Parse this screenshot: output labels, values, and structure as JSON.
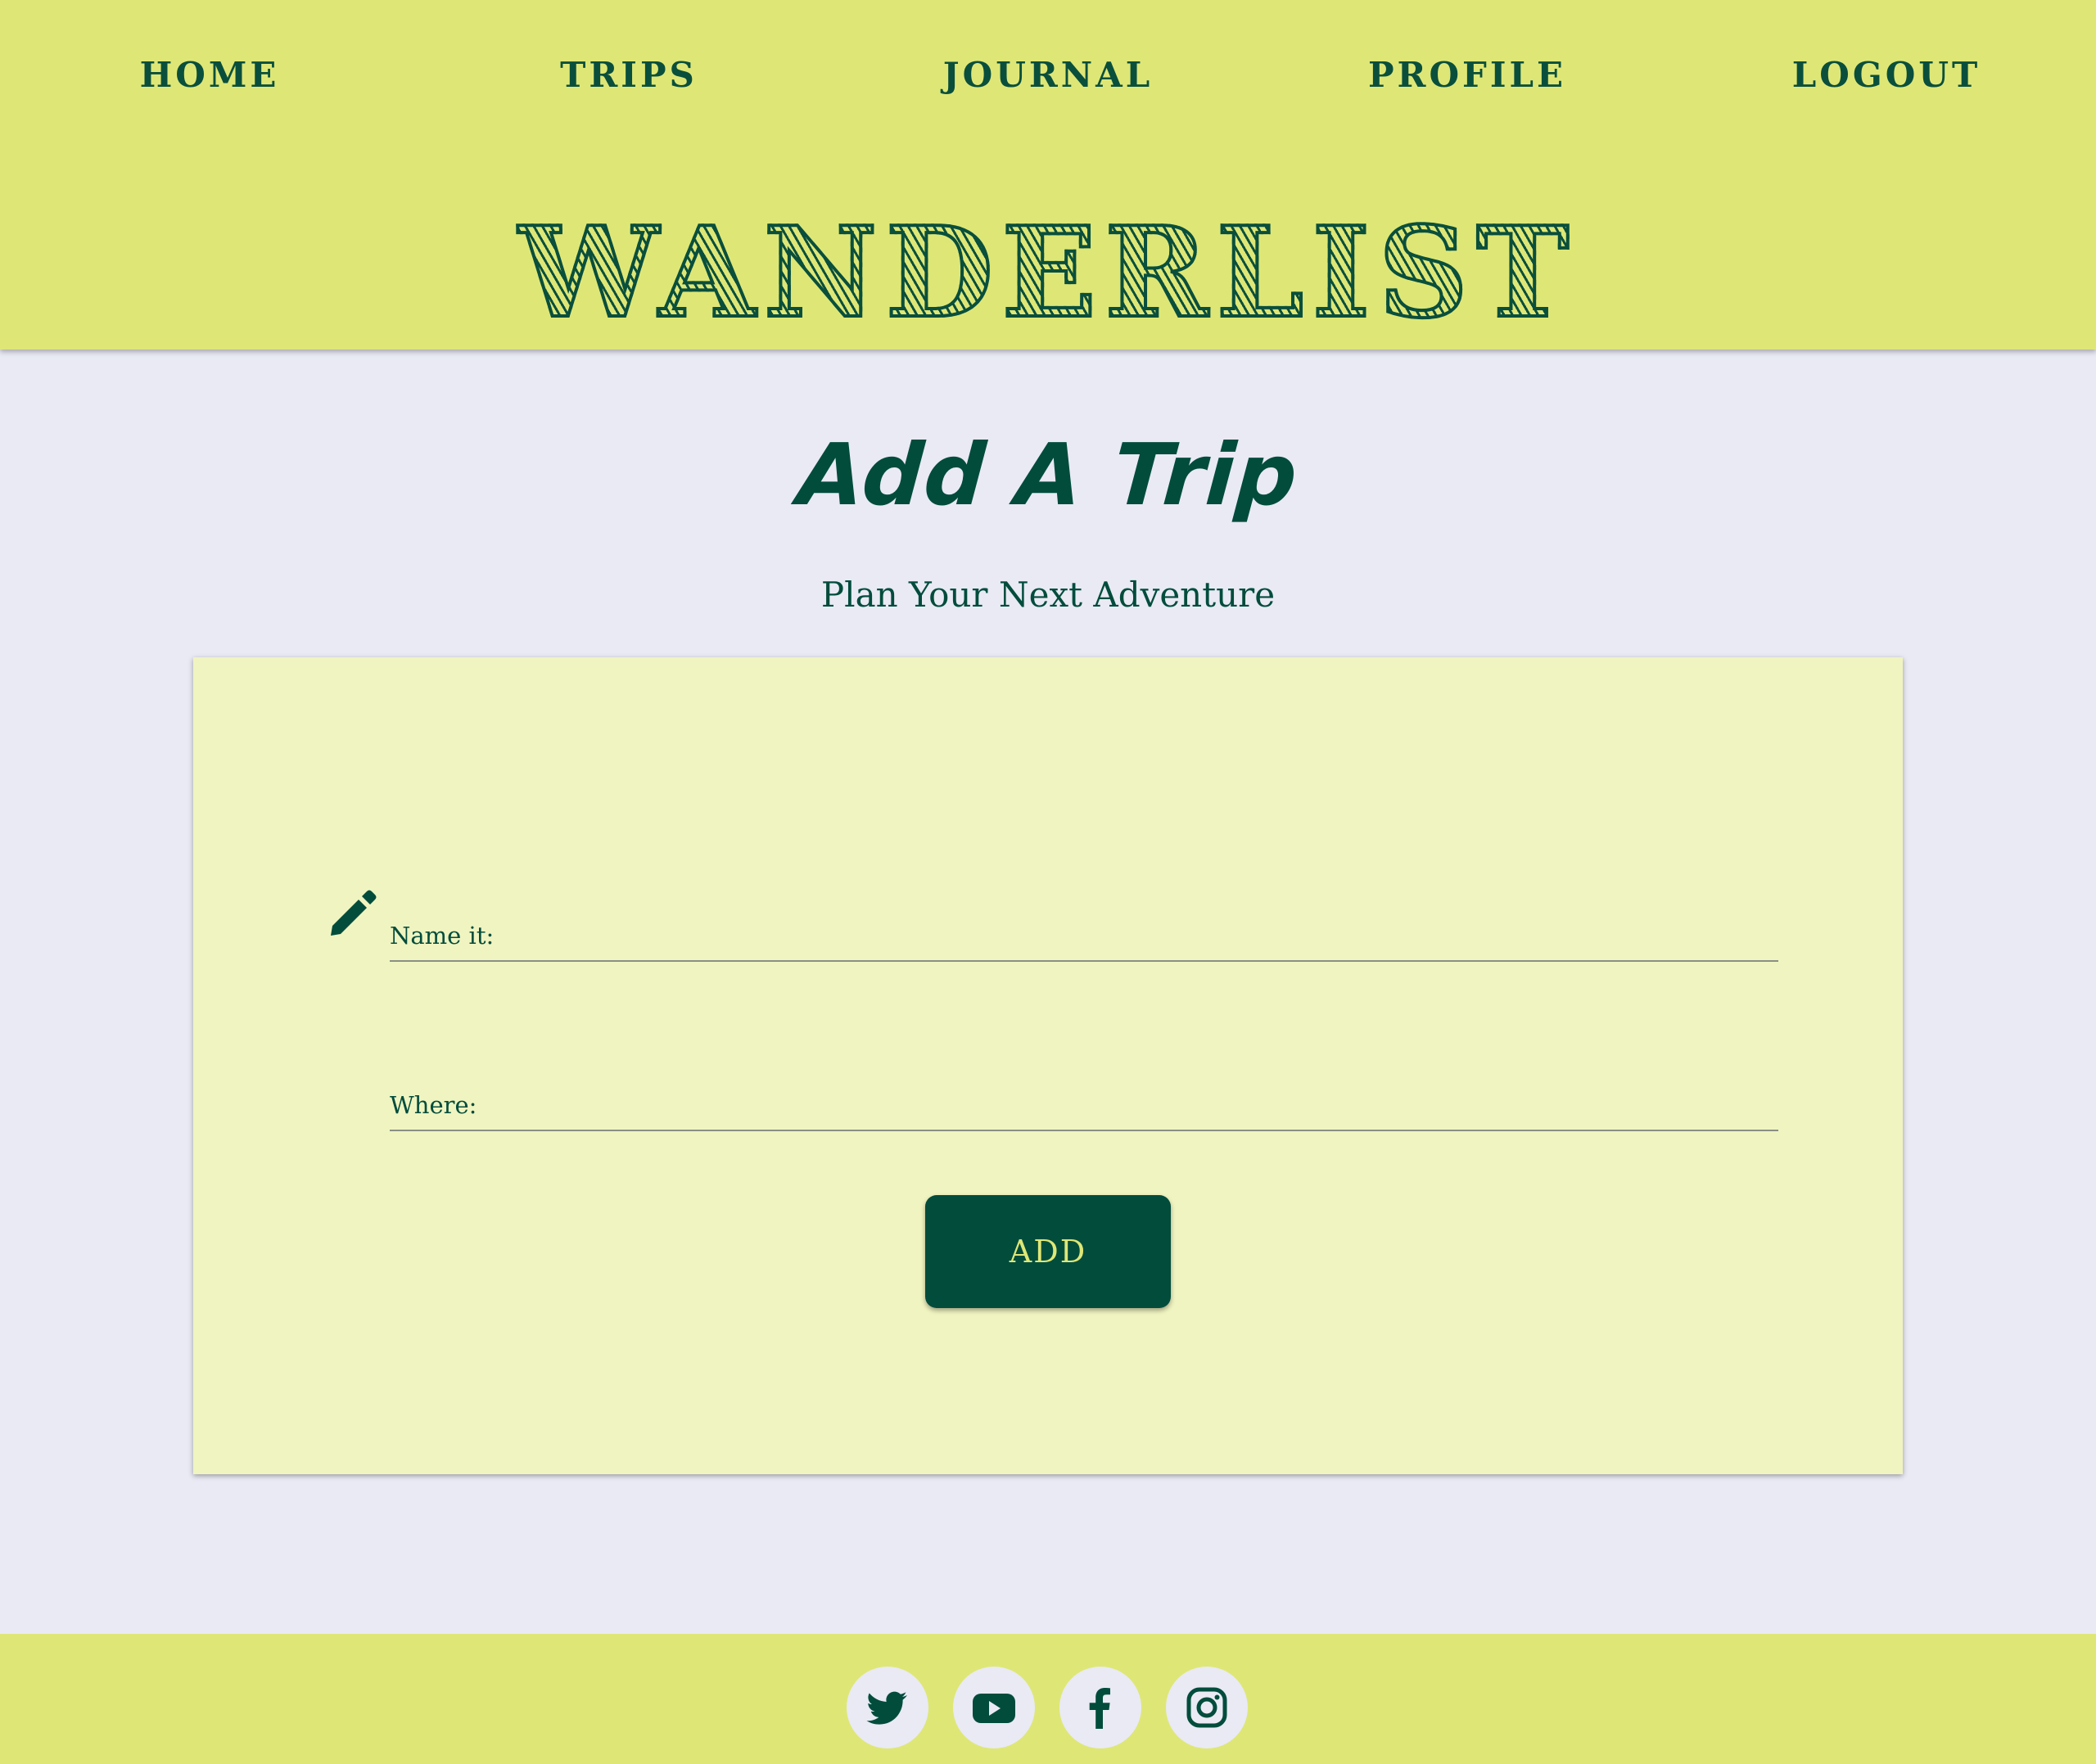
{
  "nav": {
    "items": [
      {
        "label": "HOME",
        "name": "nav-home"
      },
      {
        "label": "TRIPS",
        "name": "nav-trips"
      },
      {
        "label": "JOURNAL",
        "name": "nav-journal"
      },
      {
        "label": "PROFILE",
        "name": "nav-profile"
      },
      {
        "label": "LOGOUT",
        "name": "nav-logout"
      }
    ]
  },
  "brand": {
    "logo_text": "WANDERLIST"
  },
  "main": {
    "title": "Add A Trip",
    "subtitle": "Plan Your Next Adventure"
  },
  "form": {
    "name_label": "Name it:",
    "name_value": "",
    "where_label": "Where:",
    "where_value": "",
    "submit_label": "ADD",
    "field_icon": "pencil-icon"
  },
  "footer": {
    "social": [
      "twitter-icon",
      "youtube-icon",
      "facebook-icon",
      "instagram-icon"
    ]
  },
  "colors": {
    "header_bg": "#dee776",
    "page_bg": "#e9eaf4",
    "card_bg": "#f0f4c0",
    "accent_dark": "#024c3c"
  }
}
